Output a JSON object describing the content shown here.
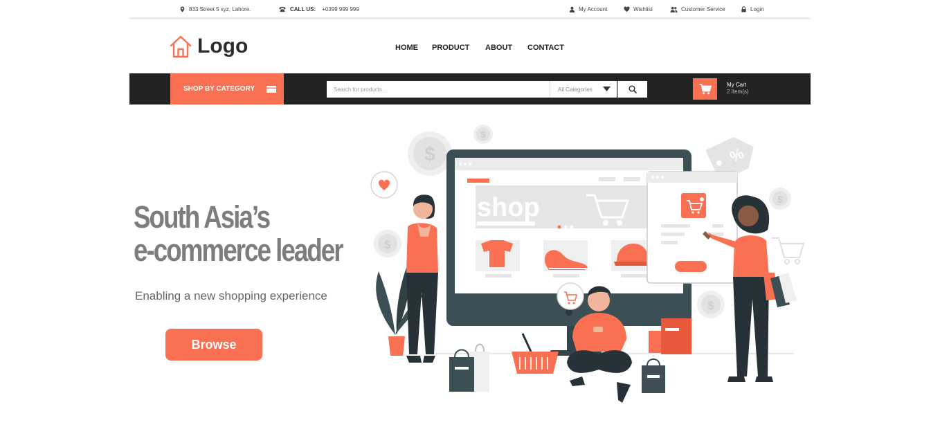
{
  "topbar": {
    "address": "833 Street 5 xyz, Lahore.",
    "call_label": "CALL US:",
    "phone": "+0399 999 999",
    "my_account": "My Account",
    "wishlist": "Wishlist",
    "customer_service": "Customer Service",
    "login": "Login"
  },
  "header": {
    "logo_text": "Logo",
    "nav": [
      "HOME",
      "PRODUCT",
      "ABOUT",
      "CONTACT"
    ]
  },
  "searchbar": {
    "shop_by_category": "SHOP BY CATEGORY",
    "search_placeholder": "Search for products...",
    "category_selected": "All Categories",
    "cart_label": "My Cart",
    "cart_count": "2 Item(s)"
  },
  "hero": {
    "title_line1": "South Asia’s",
    "title_line2": "e-commerce leader",
    "subtitle": "Enabling a new shopping experience",
    "browse_label": "Browse",
    "screen_banner_text": "shop"
  },
  "colors": {
    "accent": "#fa7052",
    "dark_bar": "#232323",
    "monitor": "#3b4f55"
  }
}
